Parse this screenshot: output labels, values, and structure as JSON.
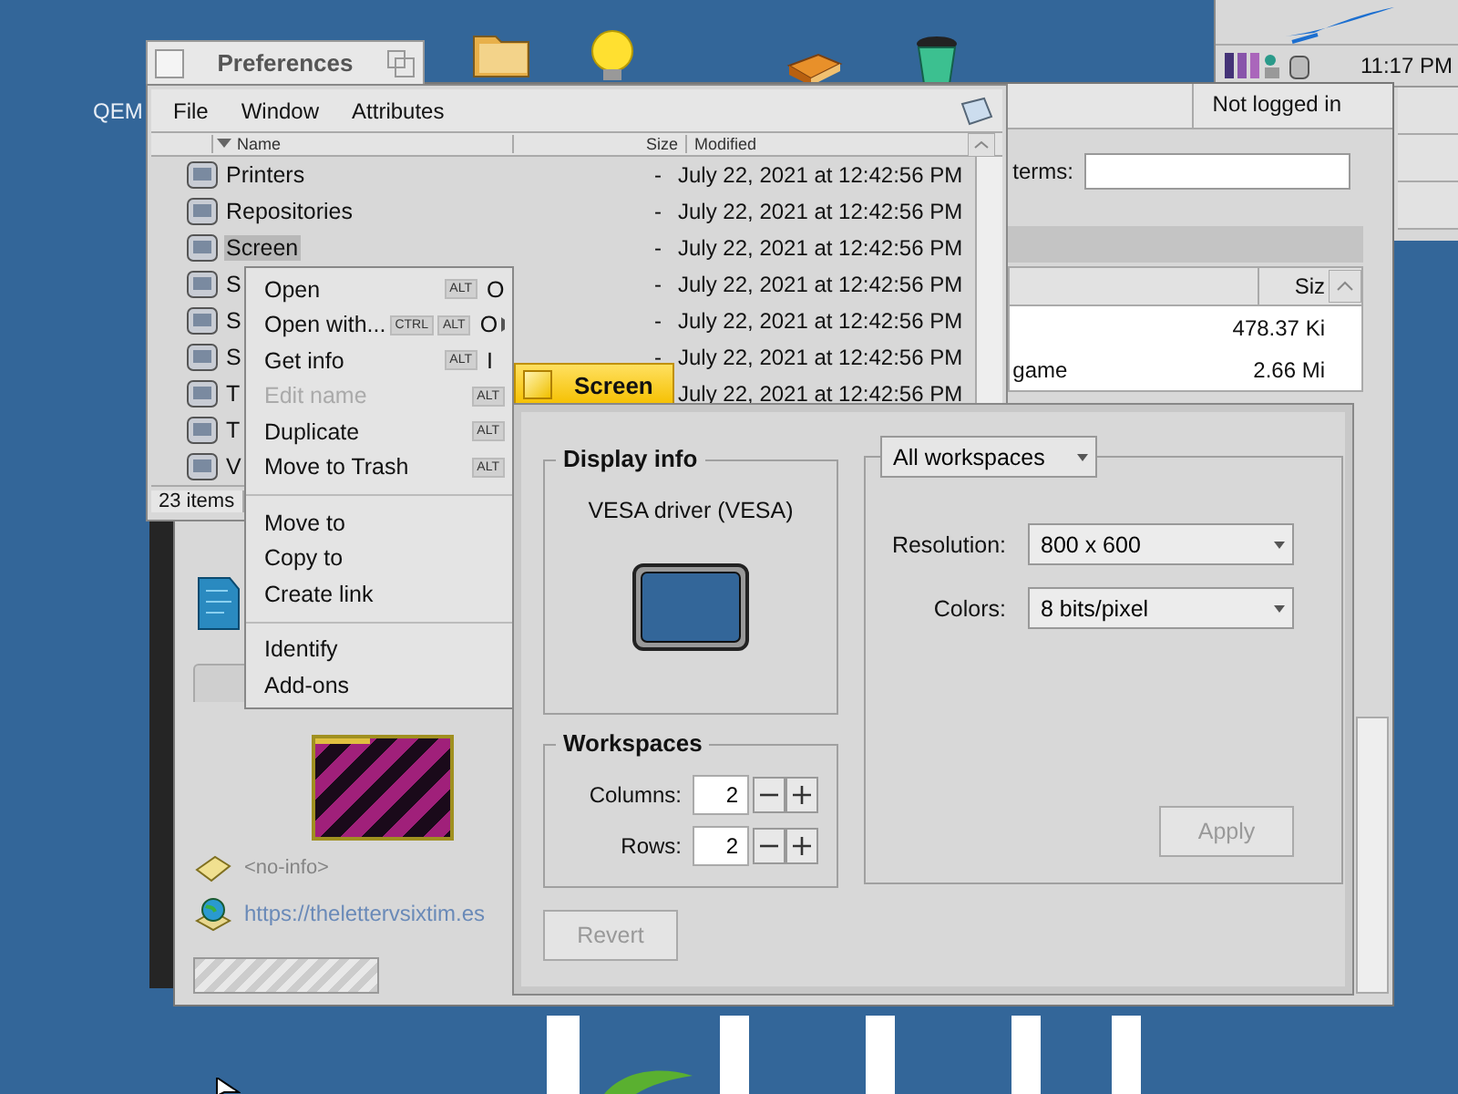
{
  "desktop": {
    "label": "QEM"
  },
  "deskbar": {
    "clock": "11:17 PM"
  },
  "depot": {
    "account_menu": "Not logged in",
    "search_label": "terms:",
    "table": {
      "columns": [
        "Siz"
      ],
      "rows": [
        {
          "size": "478.37 Ki"
        },
        {
          "name": "game",
          "size": "2.66 Mi"
        }
      ]
    },
    "no_info": "<no-info>",
    "link": "https://thelettervsixtim.es",
    "progress": {
      "level": 0
    }
  },
  "tracker": {
    "title": "Preferences",
    "menu": [
      "File",
      "Window",
      "Attributes"
    ],
    "columns": [
      "Name",
      "Size",
      "Modified"
    ],
    "rows": [
      {
        "name": "Printers",
        "size": "-",
        "modified": "July 22, 2021 at 12:42:56 PM",
        "selected": false
      },
      {
        "name": "Repositories",
        "size": "-",
        "modified": "July 22, 2021 at 12:42:56 PM",
        "selected": false
      },
      {
        "name": "Screen",
        "size": "-",
        "modified": "July 22, 2021 at 12:42:56 PM",
        "selected": true
      },
      {
        "name": "S",
        "size": "-",
        "modified": "July 22, 2021 at 12:42:56 PM",
        "selected": false
      },
      {
        "name": "S",
        "size": "-",
        "modified": "July 22, 2021 at 12:42:56 PM",
        "selected": false
      },
      {
        "name": "S",
        "size": "-",
        "modified": "July 22, 2021 at 12:42:56 PM",
        "selected": false
      },
      {
        "name": "T",
        "modified": "July 22, 2021 at 12:42:56 PM",
        "selected": false
      },
      {
        "name": "T",
        "selected": false
      },
      {
        "name": "V",
        "selected": false
      }
    ],
    "status": "23 items"
  },
  "context_menu": {
    "groups": [
      [
        {
          "label": "Open",
          "modifiers": [
            "ALT"
          ],
          "key": "O",
          "disabled": false,
          "submenu": false
        },
        {
          "label": "Open with...",
          "modifiers": [
            "CTRL",
            "ALT"
          ],
          "key": "O",
          "disabled": false,
          "submenu": true
        },
        {
          "label": "Get info",
          "modifiers": [
            "ALT"
          ],
          "key": "I",
          "disabled": false,
          "submenu": false
        },
        {
          "label": "Edit name",
          "modifiers": [
            "ALT"
          ],
          "disabled": true,
          "submenu": false
        },
        {
          "label": "Duplicate",
          "modifiers": [
            "ALT"
          ],
          "disabled": false,
          "submenu": false
        },
        {
          "label": "Move to Trash",
          "modifiers": [
            "ALT"
          ],
          "disabled": false,
          "submenu": false
        }
      ],
      [
        {
          "label": "Move to",
          "disabled": false,
          "submenu": false
        },
        {
          "label": "Copy to",
          "disabled": false,
          "submenu": false
        },
        {
          "label": "Create link",
          "disabled": false,
          "submenu": false
        }
      ],
      [
        {
          "label": "Identify",
          "disabled": false,
          "submenu": false
        },
        {
          "label": "Add-ons",
          "disabled": false,
          "submenu": false
        }
      ]
    ]
  },
  "screen": {
    "title": "Screen",
    "display_info": {
      "title": "Display info",
      "driver": "VESA driver (VESA)"
    },
    "workspaces": {
      "title": "Workspaces",
      "fields": [
        {
          "label": "Columns:",
          "value": "2"
        },
        {
          "label": "Rows:",
          "value": "2"
        }
      ]
    },
    "revert": {
      "label": "Revert",
      "disabled": true
    },
    "scope_menu": "All workspaces",
    "settings": [
      {
        "label": "Resolution:",
        "value": "800 x 600"
      },
      {
        "label": "Colors:",
        "value": "8 bits/pixel"
      }
    ],
    "apply": {
      "label": "Apply",
      "disabled": true
    }
  }
}
